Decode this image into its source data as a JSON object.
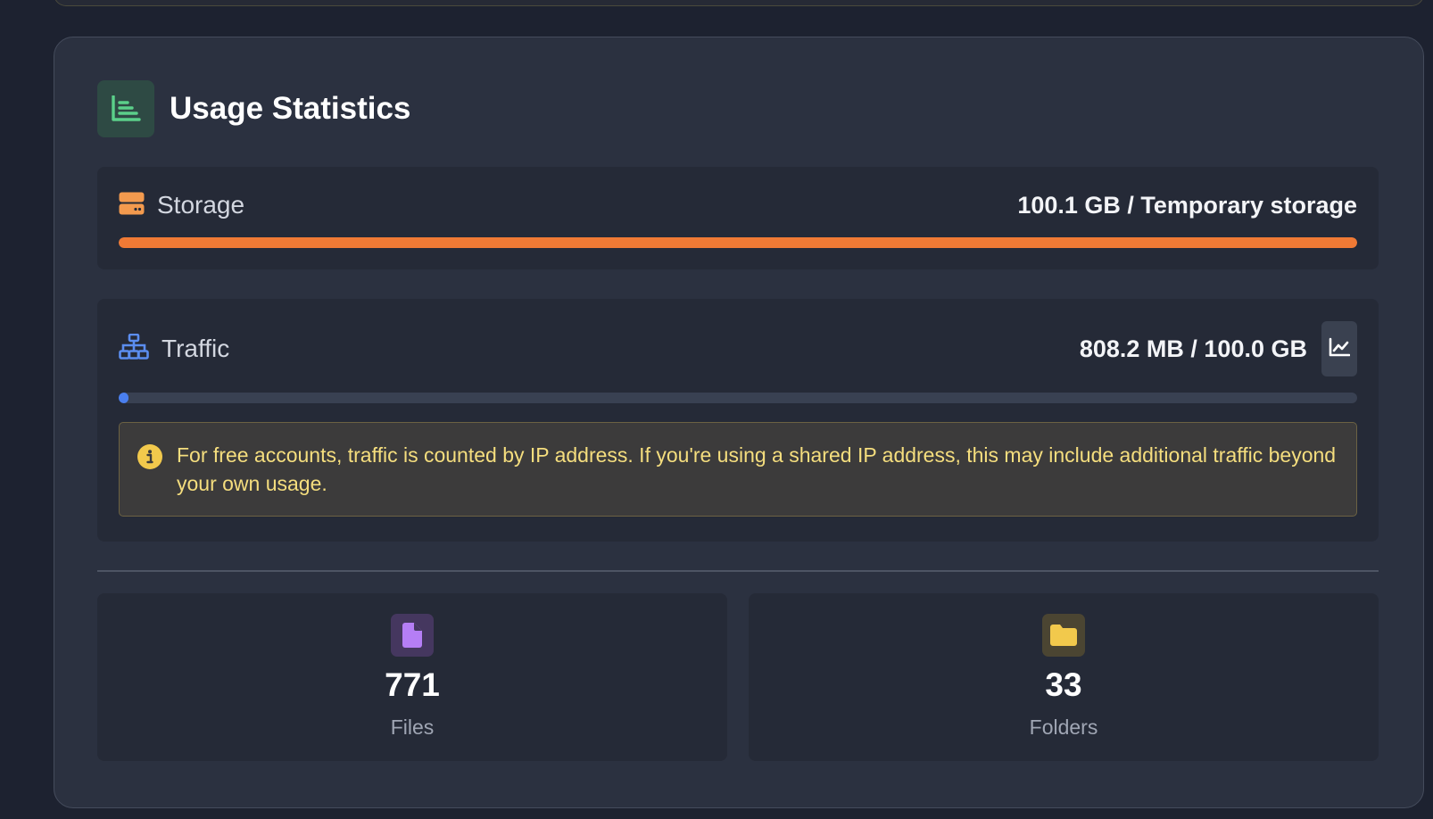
{
  "section": {
    "title": "Usage Statistics",
    "icon": "chart-bar-icon"
  },
  "storage": {
    "label": "Storage",
    "value": "100.1 GB / Temporary storage",
    "icon": "hard-drive-icon",
    "progress_fraction": 1.0,
    "bar_color": "#f07a35"
  },
  "traffic": {
    "label": "Traffic",
    "value": "808.2 MB / 100.0 GB",
    "icon": "network-icon",
    "progress_fraction": 0.008,
    "bar_color": "#4a7fef",
    "chart_button_icon": "line-chart-icon",
    "notice": "For free accounts, traffic is counted by IP address. If you're using a shared IP address, this may include additional traffic beyond your own usage.",
    "notice_icon": "info-icon"
  },
  "stats": {
    "files": {
      "value": "771",
      "label": "Files",
      "icon": "file-icon",
      "color": "#b57ef5"
    },
    "folders": {
      "value": "33",
      "label": "Folders",
      "icon": "folder-icon",
      "color": "#f2c94c"
    }
  },
  "colors": {
    "accent_green": "#5bd08a",
    "warning_text": "#f5de7e"
  }
}
